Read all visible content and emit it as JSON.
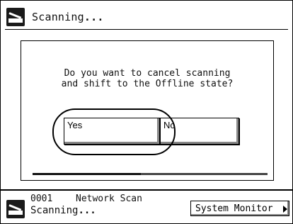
{
  "title_bar": {
    "title_text": "Scanning",
    "title_suffix": "...",
    "icon": "scanner-icon"
  },
  "dialog": {
    "message": "Do you want to cancel scanning\nand shift to the Offline state?",
    "yes_label": "Yes",
    "no_label": "No",
    "selected": "Yes",
    "progress": 0.46
  },
  "status_bar": {
    "icon": "scanner-icon",
    "job_number": "0001",
    "job_name": "Network Scan",
    "job_status": "Scanning",
    "job_status_suffix": "...",
    "system_monitor_label": "System Monitor"
  },
  "colors": {
    "background": "#ffffff",
    "foreground": "#000000",
    "shadow": "#888888"
  }
}
